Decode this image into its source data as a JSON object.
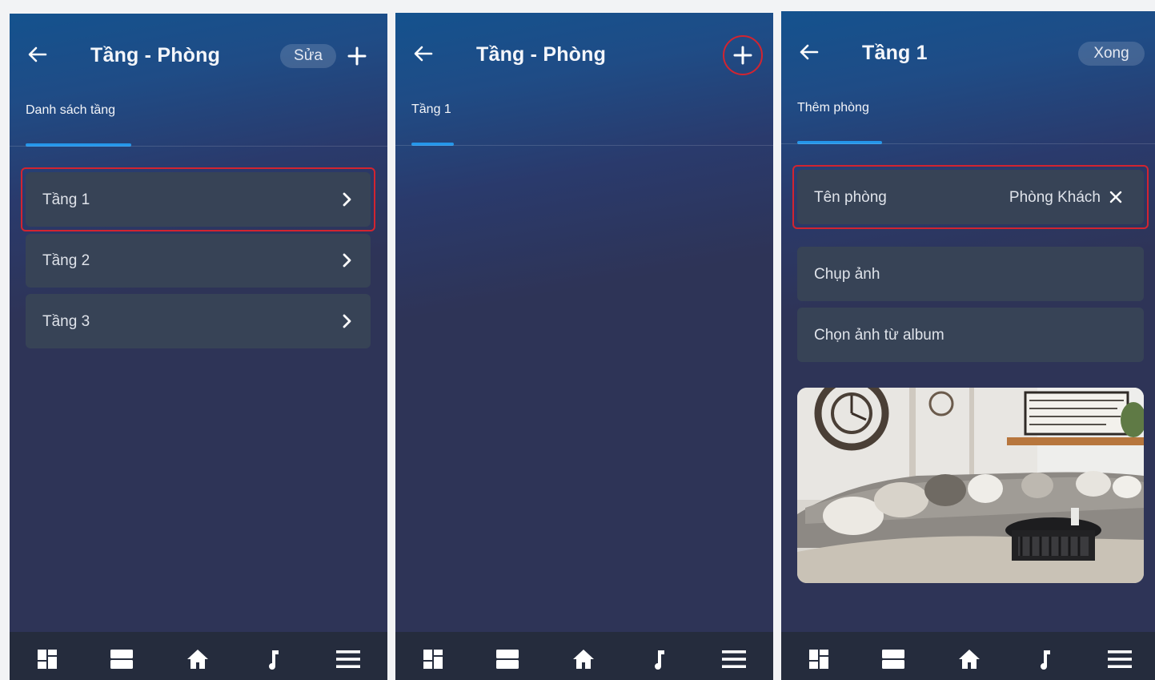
{
  "screens": [
    {
      "header": {
        "title": "Tầng - Phòng",
        "edit_label": "Sửa"
      },
      "tab": {
        "label": "Danh sách tầng"
      },
      "floors": [
        {
          "label": "Tầng 1",
          "highlighted": true
        },
        {
          "label": "Tầng 2",
          "highlighted": false
        },
        {
          "label": "Tầng 3",
          "highlighted": false
        }
      ]
    },
    {
      "header": {
        "title": "Tầng - Phòng"
      },
      "tab": {
        "label": "Tầng 1"
      }
    },
    {
      "header": {
        "title": "Tầng 1",
        "done_label": "Xong"
      },
      "tab": {
        "label": "Thêm phòng"
      },
      "room_name": {
        "label": "Tên phòng",
        "value": "Phòng Khách"
      },
      "options": [
        {
          "label": "Chụp ảnh"
        },
        {
          "label": "Chọn ảnh từ album"
        }
      ],
      "photo": {
        "subject": "living room with sectional sofa, wall clock, wall sign and round black coffee table"
      }
    }
  ],
  "bottom_nav": [
    "dashboard-icon",
    "rooms-icon",
    "home-icon",
    "music-icon",
    "menu-icon"
  ],
  "colors": {
    "background": "#2e3457",
    "header_gradient_top": "#14528e",
    "row_background": "#374356",
    "accent": "#2496ea",
    "highlight": "#d22430",
    "bottom_bar": "#252c3d"
  }
}
